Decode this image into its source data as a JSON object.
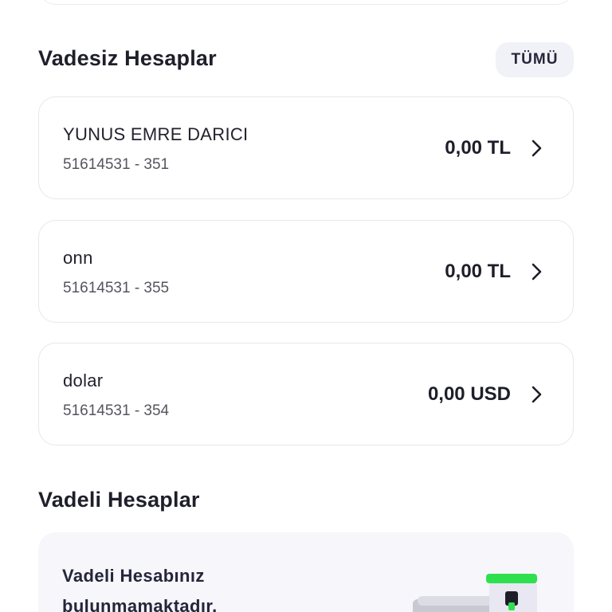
{
  "sections": {
    "demand": {
      "title": "Vadesiz Hesaplar",
      "all_button": "TÜMÜ",
      "accounts": [
        {
          "name": "YUNUS EMRE DARICI",
          "number": "51614531 - 351",
          "balance": "0,00 TL"
        },
        {
          "name": "onn",
          "number": "51614531 - 355",
          "balance": "0,00 TL"
        },
        {
          "name": "dolar",
          "number": "51614531 - 354",
          "balance": "0,00 USD"
        }
      ]
    },
    "time_deposit": {
      "title": "Vadeli Hesaplar",
      "empty_message": "Vadeli Hesabınız bulunmamaktadır."
    }
  },
  "colors": {
    "text_primary": "#1c1c28",
    "card_border": "#e8e8ee",
    "pill_bg": "#f1f1f8",
    "deposit_bg": "#f6f6fb",
    "illustration_accent": "#2fe04e"
  },
  "icons": {
    "row_chevron": "chevron-right-icon",
    "deposit_illustration": "piggy-jar-illustration"
  }
}
